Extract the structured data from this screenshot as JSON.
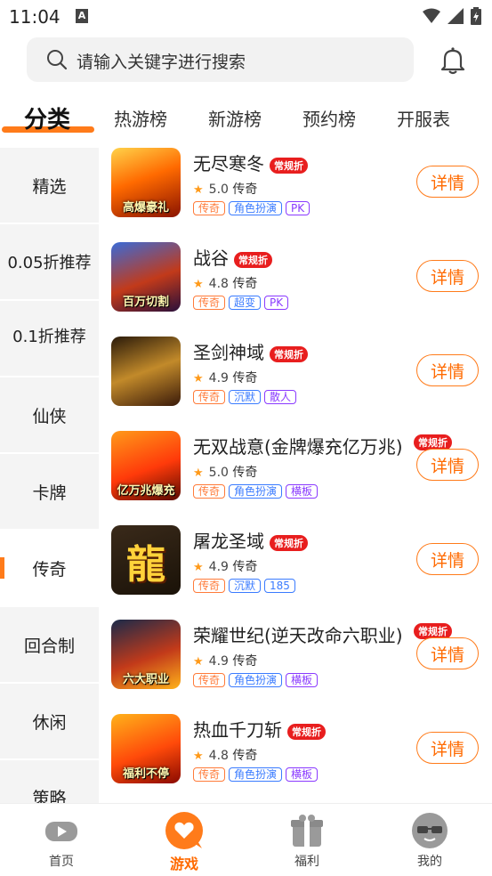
{
  "status": {
    "time": "11:04",
    "notif_letter": "A"
  },
  "search": {
    "placeholder": "请输入关键字进行搜索"
  },
  "tabs": [
    {
      "label": "分类",
      "active": true
    },
    {
      "label": "热游榜"
    },
    {
      "label": "新游榜"
    },
    {
      "label": "预约榜"
    },
    {
      "label": "开服表"
    }
  ],
  "sidebar": {
    "items": [
      {
        "label": "精选"
      },
      {
        "label": "0.05折推荐"
      },
      {
        "label": "0.1折推荐"
      },
      {
        "label": "仙侠"
      },
      {
        "label": "卡牌"
      },
      {
        "label": "传奇",
        "active": true
      },
      {
        "label": "回合制"
      },
      {
        "label": "休闲"
      },
      {
        "label": "策略"
      }
    ]
  },
  "games": [
    {
      "name": "无尽寒冬",
      "badge": "常规折",
      "rating": "5.0",
      "genre": "传奇",
      "thumb_text": "高爆豪礼",
      "thumb_glyph": "",
      "tags": [
        "传奇",
        "角色扮演",
        "PK"
      ],
      "tag_styles": [
        "t0",
        "t1",
        "t2"
      ],
      "button": "详情"
    },
    {
      "name": "战谷",
      "badge": "常规折",
      "rating": "4.8",
      "genre": "传奇",
      "thumb_text": "百万切割",
      "thumb_glyph": "",
      "tags": [
        "传奇",
        "超变",
        "PK"
      ],
      "tag_styles": [
        "t0",
        "t1",
        "t2"
      ],
      "button": "详情"
    },
    {
      "name": "圣剑神域",
      "badge": "常规折",
      "rating": "4.9",
      "genre": "传奇",
      "thumb_text": "",
      "thumb_glyph": "",
      "tags": [
        "传奇",
        "沉默",
        "散人"
      ],
      "tag_styles": [
        "t0",
        "t1",
        "t2"
      ],
      "button": "详情"
    },
    {
      "name": "无双战意(金牌爆充亿万兆)",
      "badge": "常规折",
      "rating": "5.0",
      "genre": "传奇",
      "thumb_text": "亿万兆爆充",
      "thumb_glyph": "",
      "tags": [
        "传奇",
        "角色扮演",
        "横板"
      ],
      "tag_styles": [
        "t0",
        "t1",
        "t2"
      ],
      "button": "详情"
    },
    {
      "name": "屠龙圣域",
      "badge": "常规折",
      "rating": "4.9",
      "genre": "传奇",
      "thumb_text": "",
      "thumb_glyph": "龍",
      "tags": [
        "传奇",
        "沉默",
        "185"
      ],
      "tag_styles": [
        "t0",
        "t1",
        "t1"
      ],
      "button": "详情"
    },
    {
      "name": "荣耀世纪(逆天改命六职业)",
      "badge": "常规折",
      "rating": "4.9",
      "genre": "传奇",
      "thumb_text": "六大职业",
      "thumb_glyph": "",
      "tags": [
        "传奇",
        "角色扮演",
        "横板"
      ],
      "tag_styles": [
        "t0",
        "t1",
        "t2"
      ],
      "button": "详情"
    },
    {
      "name": "热血千刀斩",
      "badge": "常规折",
      "rating": "4.8",
      "genre": "传奇",
      "thumb_text": "福利不停",
      "thumb_glyph": "",
      "tags": [
        "传奇",
        "角色扮演",
        "横板"
      ],
      "tag_styles": [
        "t0",
        "t1",
        "t2"
      ],
      "button": "详情"
    }
  ],
  "bottom_nav": [
    {
      "label": "首页",
      "icon": "gamepad-icon"
    },
    {
      "label": "游戏",
      "icon": "heart-chat-icon",
      "active": true
    },
    {
      "label": "福利",
      "icon": "gift-icon"
    },
    {
      "label": "我的",
      "icon": "sunglasses-face-icon"
    }
  ],
  "colors": {
    "accent": "#ff7b1a",
    "badge": "#e81e1e",
    "tag_orange": "#ff7b3a",
    "tag_blue": "#3a7bff",
    "tag_purple": "#8a3aff"
  }
}
